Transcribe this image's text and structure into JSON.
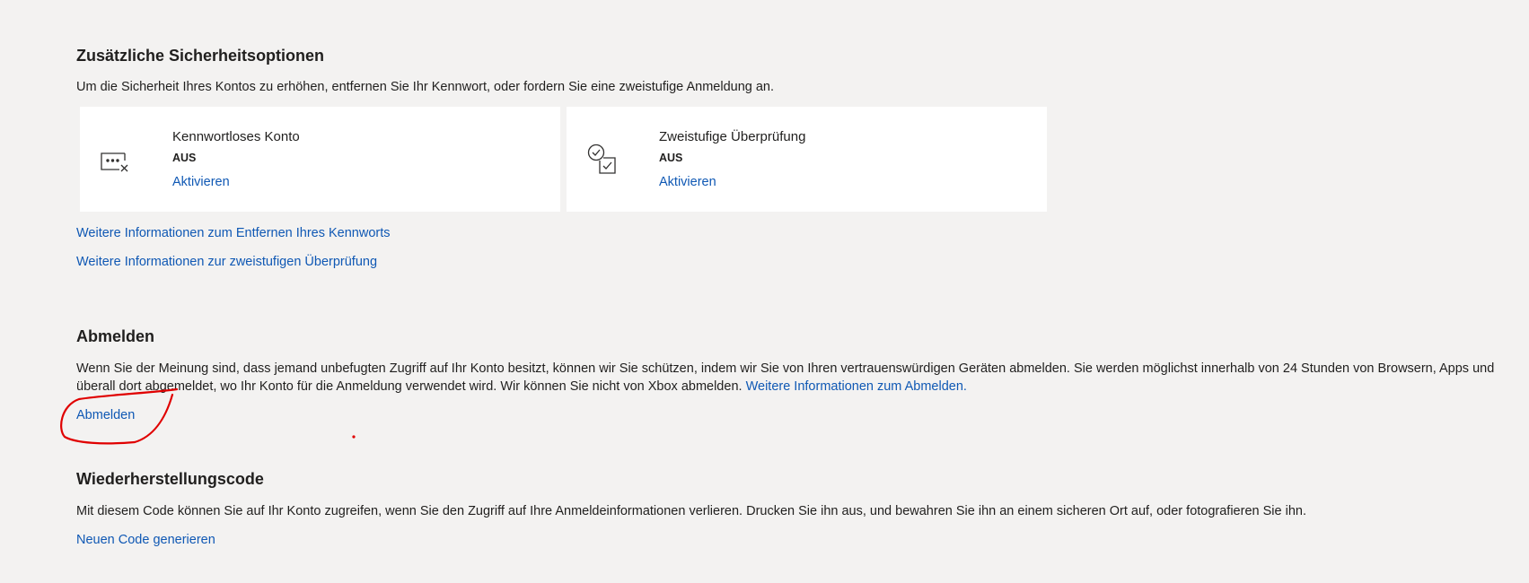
{
  "security_options": {
    "title": "Zusätzliche Sicherheitsoptionen",
    "description": "Um die Sicherheit Ihres Kontos zu erhöhen, entfernen Sie Ihr Kennwort, oder fordern Sie eine zweistufige Anmeldung an.",
    "cards": [
      {
        "title": "Kennwortloses Konto",
        "status": "AUS",
        "action": "Aktivieren",
        "icon": "passwordless-icon"
      },
      {
        "title": "Zweistufige Überprüfung",
        "status": "AUS",
        "action": "Aktivieren",
        "icon": "two-step-verification-icon"
      }
    ],
    "links": [
      "Weitere Informationen zum Entfernen Ihres Kennworts",
      "Weitere Informationen zur zweistufigen Überprüfung"
    ]
  },
  "sign_out": {
    "title": "Abmelden",
    "description": "Wenn Sie der Meinung sind, dass jemand unbefugten Zugriff auf Ihr Konto besitzt, können wir Sie schützen, indem wir Sie von Ihren vertrauenswürdigen Geräten abmelden. Sie werden möglichst innerhalb von 24 Stunden von Browsern, Apps und überall dort abgemeldet, wo Ihr Konto für die Anmeldung verwendet wird. Wir können Sie nicht von Xbox abmelden.",
    "info_link": "Weitere Informationen zum Abmelden.",
    "action": "Abmelden"
  },
  "recovery_code": {
    "title": "Wiederherstellungscode",
    "description": "Mit diesem Code können Sie auf Ihr Konto zugreifen, wenn Sie den Zugriff auf Ihre Anmeldeinformationen verlieren. Drucken Sie ihn aus, und bewahren Sie ihn an einem sicheren Ort auf, oder fotografieren Sie ihn.",
    "action": "Neuen Code generieren"
  },
  "colors": {
    "background": "#f3f2f1",
    "card": "#ffffff",
    "link": "#0f58b4",
    "text": "#201f1e",
    "annotation": "#e00000"
  }
}
